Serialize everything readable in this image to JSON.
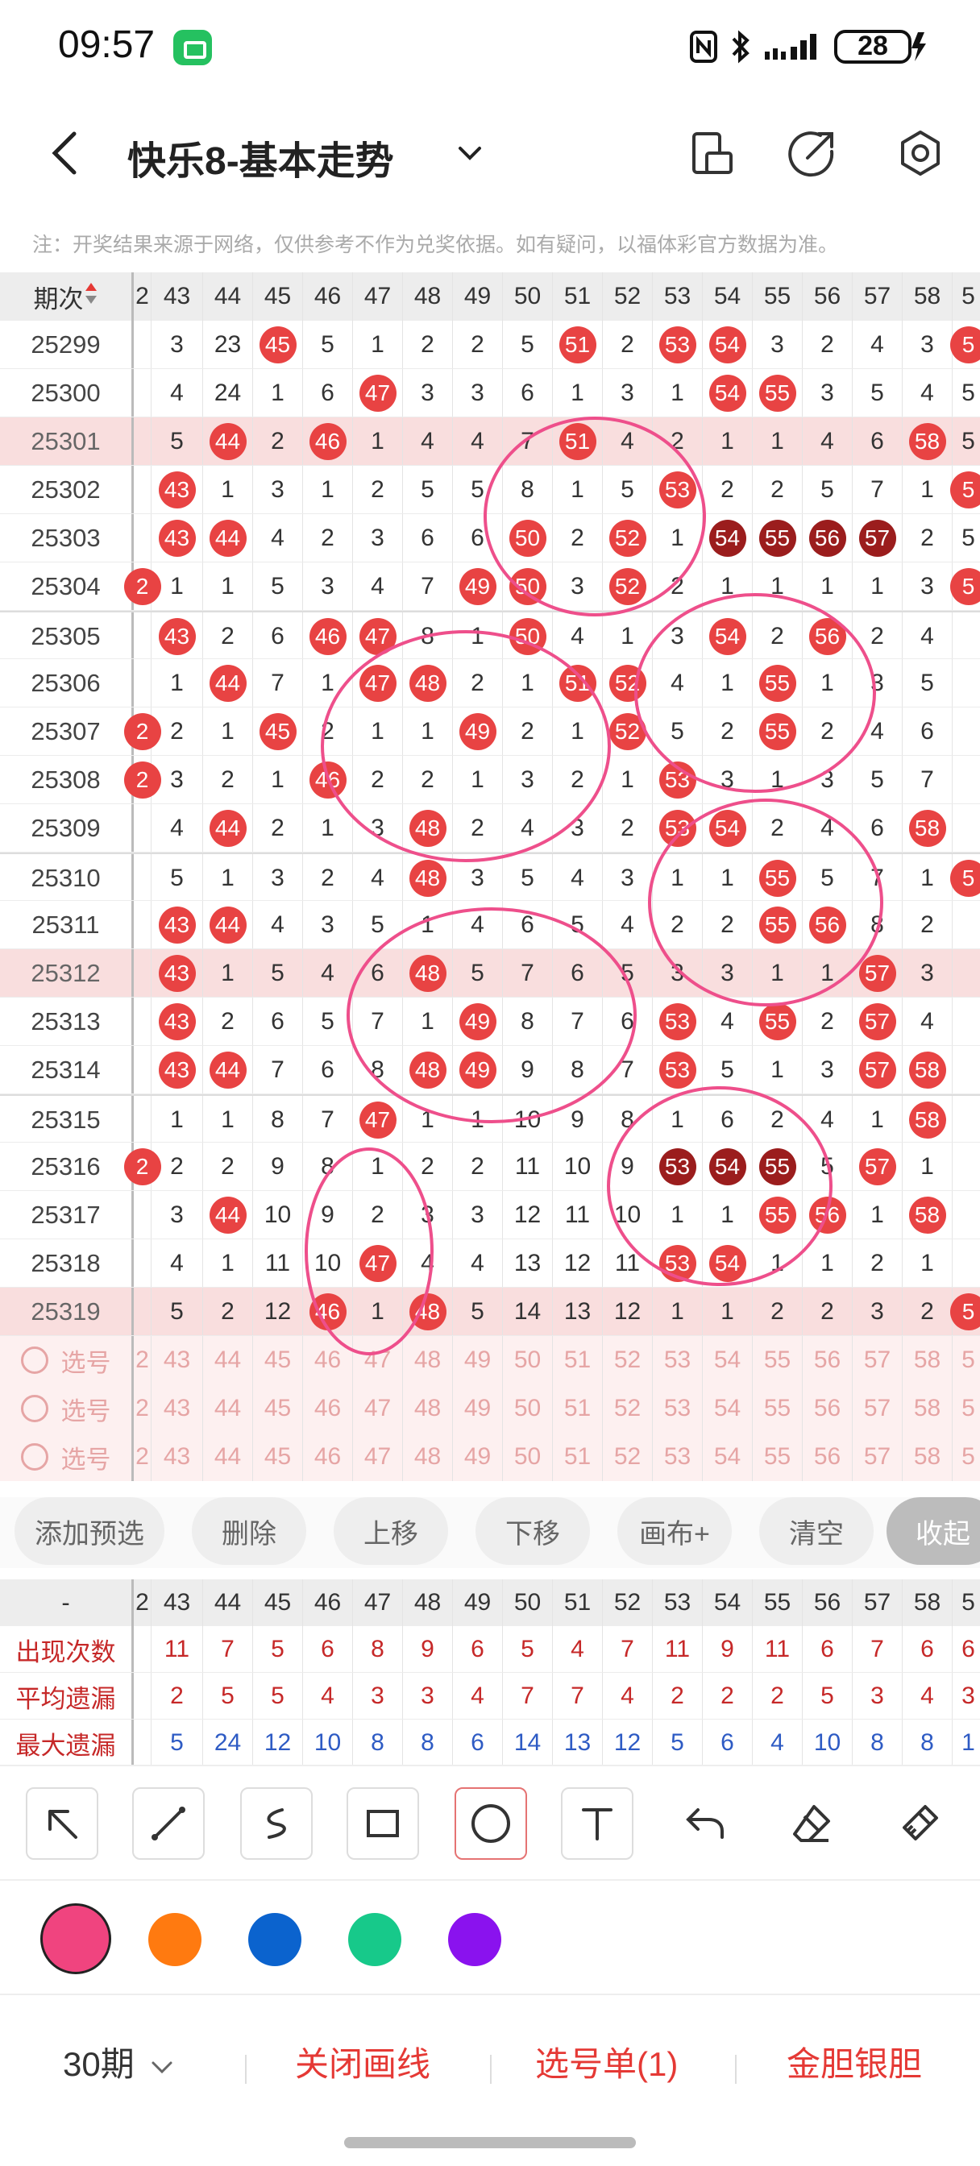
{
  "status": {
    "time": "09:57",
    "battery": "28"
  },
  "header": {
    "title": "快乐8-基本走势"
  },
  "note": "注：开奖结果来源于网络，仅供参考不作为兑奖依据。如有疑问，以福体彩官方数据为准。",
  "grid": {
    "period_header": "期次",
    "col_headers": [
      "2",
      "43",
      "44",
      "45",
      "46",
      "47",
      "48",
      "49",
      "50",
      "51",
      "52",
      "53",
      "54",
      "55",
      "56",
      "57",
      "58",
      "5"
    ],
    "rows": [
      {
        "p": "25299",
        "c": [
          "",
          "3",
          "23",
          "45",
          "5",
          "1",
          "2",
          "2",
          "5",
          "51",
          "2",
          "53",
          "54",
          "3",
          "2",
          "4",
          "3",
          "5"
        ],
        "b": [
          3,
          9,
          11,
          12,
          17
        ]
      },
      {
        "p": "25300",
        "c": [
          "",
          "4",
          "24",
          "1",
          "6",
          "47",
          "3",
          "3",
          "6",
          "1",
          "3",
          "1",
          "54",
          "55",
          "3",
          "5",
          "4",
          "5"
        ],
        "b": [
          5,
          12,
          13
        ]
      },
      {
        "p": "25301",
        "c": [
          "",
          "5",
          "44",
          "2",
          "46",
          "1",
          "4",
          "4",
          "7",
          "51",
          "4",
          "2",
          "1",
          "1",
          "4",
          "6",
          "58",
          "5"
        ],
        "b": [
          2,
          4,
          9,
          16
        ],
        "hl": true
      },
      {
        "p": "25302",
        "c": [
          "",
          "43",
          "1",
          "3",
          "1",
          "2",
          "5",
          "5",
          "8",
          "1",
          "5",
          "53",
          "2",
          "2",
          "5",
          "7",
          "1",
          "5"
        ],
        "b": [
          1,
          11,
          17
        ]
      },
      {
        "p": "25303",
        "c": [
          "",
          "43",
          "44",
          "4",
          "2",
          "3",
          "6",
          "6",
          "50",
          "2",
          "52",
          "1",
          "54",
          "55",
          "56",
          "57",
          "2",
          "5"
        ],
        "b": [
          1,
          2,
          8,
          10
        ],
        "d": [
          12,
          13,
          14,
          15
        ]
      },
      {
        "p": "25304",
        "c": [
          "2",
          "1",
          "1",
          "5",
          "3",
          "4",
          "7",
          "49",
          "50",
          "3",
          "52",
          "2",
          "1",
          "1",
          "1",
          "1",
          "3",
          "5"
        ],
        "b": [
          0,
          7,
          8,
          10,
          17
        ]
      },
      {
        "p": "25305",
        "c": [
          "",
          "43",
          "2",
          "6",
          "46",
          "47",
          "8",
          "1",
          "50",
          "4",
          "1",
          "3",
          "54",
          "2",
          "56",
          "2",
          "4",
          ""
        ],
        "b": [
          1,
          4,
          5,
          8,
          12,
          14
        ],
        "g": true
      },
      {
        "p": "25306",
        "c": [
          "",
          "1",
          "44",
          "7",
          "1",
          "47",
          "48",
          "2",
          "1",
          "51",
          "52",
          "4",
          "1",
          "55",
          "1",
          "3",
          "5",
          ""
        ],
        "b": [
          2,
          5,
          6,
          9,
          10,
          13
        ]
      },
      {
        "p": "25307",
        "c": [
          "2",
          "2",
          "1",
          "45",
          "2",
          "1",
          "1",
          "49",
          "2",
          "1",
          "52",
          "5",
          "2",
          "55",
          "2",
          "4",
          "6",
          ""
        ],
        "b": [
          0,
          3,
          7,
          10,
          13
        ]
      },
      {
        "p": "25308",
        "c": [
          "2",
          "3",
          "2",
          "1",
          "46",
          "2",
          "2",
          "1",
          "3",
          "2",
          "1",
          "53",
          "3",
          "1",
          "3",
          "5",
          "7",
          ""
        ],
        "b": [
          0,
          4,
          11
        ]
      },
      {
        "p": "25309",
        "c": [
          "",
          "4",
          "44",
          "2",
          "1",
          "3",
          "48",
          "2",
          "4",
          "3",
          "2",
          "53",
          "54",
          "2",
          "4",
          "6",
          "58",
          ""
        ],
        "b": [
          2,
          6,
          11,
          12,
          16
        ]
      },
      {
        "p": "25310",
        "c": [
          "",
          "5",
          "1",
          "3",
          "2",
          "4",
          "48",
          "3",
          "5",
          "4",
          "3",
          "1",
          "1",
          "55",
          "5",
          "7",
          "1",
          "5"
        ],
        "b": [
          6,
          13,
          17
        ],
        "g": true
      },
      {
        "p": "25311",
        "c": [
          "",
          "43",
          "44",
          "4",
          "3",
          "5",
          "1",
          "4",
          "6",
          "5",
          "4",
          "2",
          "2",
          "55",
          "56",
          "8",
          "2",
          ""
        ],
        "b": [
          1,
          2,
          13,
          14
        ]
      },
      {
        "p": "25312",
        "c": [
          "",
          "43",
          "1",
          "5",
          "4",
          "6",
          "48",
          "5",
          "7",
          "6",
          "5",
          "3",
          "3",
          "1",
          "1",
          "57",
          "3",
          ""
        ],
        "b": [
          1,
          6,
          15
        ],
        "hl": true
      },
      {
        "p": "25313",
        "c": [
          "",
          "43",
          "2",
          "6",
          "5",
          "7",
          "1",
          "49",
          "8",
          "7",
          "6",
          "53",
          "4",
          "55",
          "2",
          "57",
          "4",
          ""
        ],
        "b": [
          1,
          7,
          11,
          13,
          15
        ]
      },
      {
        "p": "25314",
        "c": [
          "",
          "43",
          "44",
          "7",
          "6",
          "8",
          "48",
          "49",
          "9",
          "8",
          "7",
          "53",
          "5",
          "1",
          "3",
          "57",
          "58",
          ""
        ],
        "b": [
          1,
          2,
          6,
          7,
          11,
          15,
          16
        ]
      },
      {
        "p": "25315",
        "c": [
          "",
          "1",
          "1",
          "8",
          "7",
          "47",
          "1",
          "1",
          "10",
          "9",
          "8",
          "1",
          "6",
          "2",
          "4",
          "1",
          "58",
          ""
        ],
        "b": [
          5,
          16
        ],
        "g": true
      },
      {
        "p": "25316",
        "c": [
          "2",
          "2",
          "2",
          "9",
          "8",
          "1",
          "2",
          "2",
          "11",
          "10",
          "9",
          "53",
          "54",
          "55",
          "5",
          "57",
          "1",
          ""
        ],
        "b": [
          0,
          15
        ],
        "d": [
          11,
          12,
          13
        ]
      },
      {
        "p": "25317",
        "c": [
          "",
          "3",
          "44",
          "10",
          "9",
          "2",
          "3",
          "3",
          "12",
          "11",
          "10",
          "1",
          "1",
          "55",
          "56",
          "1",
          "58",
          ""
        ],
        "b": [
          2,
          13,
          14,
          16
        ]
      },
      {
        "p": "25318",
        "c": [
          "",
          "4",
          "1",
          "11",
          "10",
          "47",
          "4",
          "4",
          "13",
          "12",
          "11",
          "53",
          "54",
          "1",
          "1",
          "2",
          "1",
          ""
        ],
        "b": [
          5,
          11,
          12
        ]
      },
      {
        "p": "25319",
        "c": [
          "",
          "5",
          "2",
          "12",
          "46",
          "1",
          "48",
          "5",
          "14",
          "13",
          "12",
          "1",
          "1",
          "2",
          "2",
          "3",
          "2",
          "5"
        ],
        "b": [
          4,
          6,
          17
        ],
        "hl": true
      }
    ],
    "pick_label": "选号",
    "pick_values": [
      "2",
      "43",
      "44",
      "45",
      "46",
      "47",
      "48",
      "49",
      "50",
      "51",
      "52",
      "53",
      "54",
      "55",
      "56",
      "57",
      "58",
      "5"
    ]
  },
  "buttons": [
    "添加预选",
    "删除",
    "上移",
    "下移",
    "画布+",
    "清空",
    "收起"
  ],
  "stats": {
    "header_dash": "-",
    "headers": [
      "2",
      "43",
      "44",
      "45",
      "46",
      "47",
      "48",
      "49",
      "50",
      "51",
      "52",
      "53",
      "54",
      "55",
      "56",
      "57",
      "58",
      "5"
    ],
    "rows": [
      {
        "label": "出现次数",
        "values": [
          "",
          "11",
          "7",
          "5",
          "6",
          "8",
          "9",
          "6",
          "5",
          "4",
          "7",
          "11",
          "9",
          "11",
          "6",
          "7",
          "6",
          "6"
        ],
        "color": "#c62828"
      },
      {
        "label": "平均遗漏",
        "values": [
          "",
          "2",
          "5",
          "5",
          "4",
          "3",
          "3",
          "4",
          "7",
          "7",
          "4",
          "2",
          "2",
          "2",
          "5",
          "3",
          "4",
          "3"
        ],
        "color": "#c62828"
      },
      {
        "label": "最大遗漏",
        "values": [
          "",
          "5",
          "24",
          "12",
          "10",
          "8",
          "8",
          "6",
          "14",
          "13",
          "12",
          "5",
          "6",
          "4",
          "10",
          "8",
          "8",
          "1"
        ],
        "color": "#2e5bc4"
      }
    ]
  },
  "palette": [
    "#f0447f",
    "#ff7a10",
    "#0b63ce",
    "#17c98a",
    "#8a12ee"
  ],
  "bottom": {
    "period_select": "30期",
    "close_lines": "关闭画线",
    "pick_list": "选号单(1)",
    "gold_silver": "金胆银胆"
  }
}
